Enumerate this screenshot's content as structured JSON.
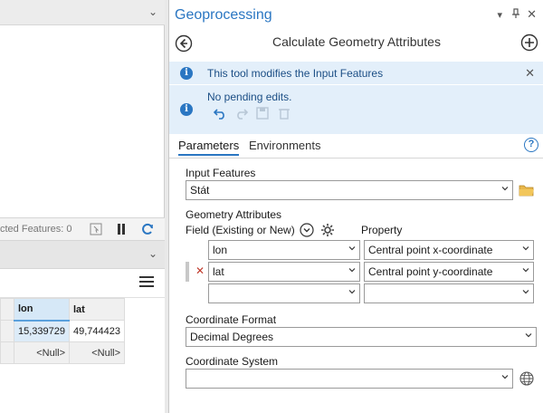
{
  "left": {
    "status_text": "cted Features: 0",
    "table": {
      "columns": [
        "lon",
        "lat"
      ],
      "rows": [
        [
          "15,339729",
          "49,744423"
        ],
        [
          "<Null>",
          "<Null>"
        ]
      ]
    }
  },
  "gp": {
    "title": "Geoprocessing",
    "tool_name": "Calculate Geometry Attributes",
    "info_message": "This tool modifies the Input Features",
    "edits_message": "No pending edits.",
    "tabs": {
      "parameters": "Parameters",
      "environments": "Environments"
    },
    "input_features_label": "Input Features",
    "input_features_value": "Stát",
    "geometry_attributes_label": "Geometry Attributes",
    "field_label": "Field (Existing or New)",
    "property_label": "Property",
    "rows": [
      {
        "field": "lon",
        "property": "Central point x-coordinate"
      },
      {
        "field": "lat",
        "property": "Central point y-coordinate"
      },
      {
        "field": "",
        "property": ""
      }
    ],
    "coordinate_format_label": "Coordinate Format",
    "coordinate_format_value": "Decimal Degrees",
    "coordinate_system_label": "Coordinate System",
    "coordinate_system_value": ""
  },
  "colors": {
    "accent": "#2a76c2",
    "info_bg": "#e3effa",
    "delete": "#c0392b"
  }
}
